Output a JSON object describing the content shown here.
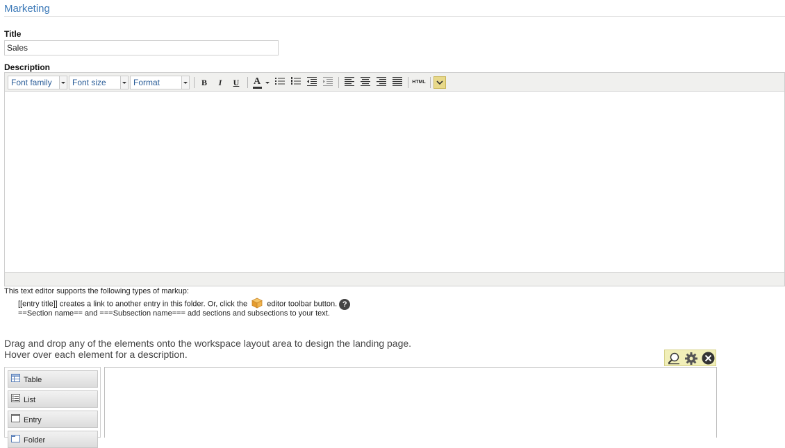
{
  "section": {
    "title": "Marketing"
  },
  "title_field": {
    "label": "Title",
    "value": "Sales"
  },
  "description": {
    "label": "Description",
    "toolbar": {
      "font_family": "Font family",
      "font_size": "Font size",
      "format": "Format",
      "bold": "B",
      "italic": "I",
      "underline": "U",
      "text_color": "A",
      "html": "HTML"
    }
  },
  "markup_help": {
    "intro": "This text editor supports the following types of markup:",
    "line1_prefix": "[[entry title]] creates a link to another entry in this folder. Or, click the",
    "line1_suffix": "editor toolbar button.",
    "help_icon": "?",
    "line2": "==Section name== and ===Subsection name=== add sections and subsections to your text."
  },
  "instructions": {
    "line1": "Drag and drop any of the elements onto the workspace layout area to design the landing page.",
    "line2": "Hover over each element for a description."
  },
  "palette": {
    "items": [
      {
        "label": "Table",
        "icon": "table-icon"
      },
      {
        "label": "List",
        "icon": "list-icon"
      },
      {
        "label": "Entry",
        "icon": "entry-icon"
      },
      {
        "label": "Folder",
        "icon": "folder-icon"
      }
    ]
  },
  "colors": {
    "section_title": "#3d7ab8",
    "toolbar_bg": "#f0f0ee",
    "workspace_tools_bg": "#f1efb8"
  }
}
